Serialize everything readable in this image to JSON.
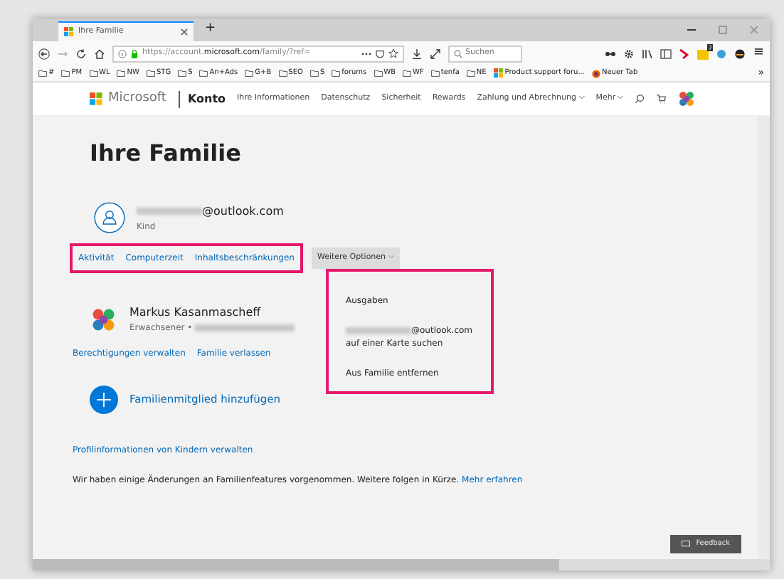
{
  "browser": {
    "tab": {
      "title": "Ihre Familie",
      "selected": true
    },
    "new_tab": "+",
    "url": {
      "prefix": "https://account.",
      "domain": "microsoft.com",
      "path": "/family/?ref="
    },
    "search": {
      "placeholder": "Suchen"
    },
    "extension_badge": "7",
    "menu_glyph": "≡",
    "bookmarks": [
      {
        "label": "#",
        "kind": "folder"
      },
      {
        "label": "PM",
        "kind": "folder"
      },
      {
        "label": "WL",
        "kind": "folder"
      },
      {
        "label": "NW",
        "kind": "folder"
      },
      {
        "label": "STG",
        "kind": "folder"
      },
      {
        "label": "S",
        "kind": "folder"
      },
      {
        "label": "An+Ads",
        "kind": "folder"
      },
      {
        "label": "G+B",
        "kind": "folder"
      },
      {
        "label": "SEO",
        "kind": "folder"
      },
      {
        "label": "S",
        "kind": "folder"
      },
      {
        "label": "forums",
        "kind": "folder"
      },
      {
        "label": "WB",
        "kind": "folder"
      },
      {
        "label": "WF",
        "kind": "folder"
      },
      {
        "label": "tenfa",
        "kind": "folder"
      },
      {
        "label": "NE",
        "kind": "folder"
      },
      {
        "label": "Product support foru...",
        "kind": "tiles"
      },
      {
        "label": "Neuer Tab",
        "kind": "firefox"
      }
    ],
    "bookmarks_overflow": "»"
  },
  "site_header": {
    "brand": "Microsoft",
    "section": "Konto",
    "nav": [
      {
        "label": "Ihre Informationen",
        "dropdown": false
      },
      {
        "label": "Datenschutz",
        "dropdown": false
      },
      {
        "label": "Sicherheit",
        "dropdown": false
      },
      {
        "label": "Rewards",
        "dropdown": false
      },
      {
        "label": "Zahlung und Abrechnung",
        "dropdown": true
      },
      {
        "label": "Mehr",
        "dropdown": true
      }
    ]
  },
  "page": {
    "title": "Ihre Familie",
    "child": {
      "email_suffix": "@outlook.com",
      "role": "Kind",
      "links": [
        "Aktivität",
        "Computerzeit",
        "Inhaltsbeschränkungen"
      ],
      "links_highlighted": true,
      "more_button": "Weitere Optionen",
      "menu": {
        "open": true,
        "highlighted": true,
        "items": [
          {
            "text": "Ausgaben",
            "redacted_prefix": false
          },
          {
            "text": "@outlook.com auf einer Karte suchen",
            "redacted_prefix": true
          },
          {
            "text": "Aus Familie entfernen",
            "redacted_prefix": false
          }
        ]
      }
    },
    "adult": {
      "name": "Markus Kasanmascheff",
      "role": "Erwachsener •",
      "links": [
        "Berechtigungen verwalten",
        "Familie verlassen"
      ]
    },
    "add_member": "Familienmitglied hinzufügen",
    "manage_link": "Profilinformationen von Kindern verwalten",
    "notice": {
      "text": "Wir haben einige Änderungen an Familienfeatures vorgenommen. Weitere folgen in Kürze.",
      "link": "Mehr erfahren"
    },
    "feedback": "Feedback"
  }
}
